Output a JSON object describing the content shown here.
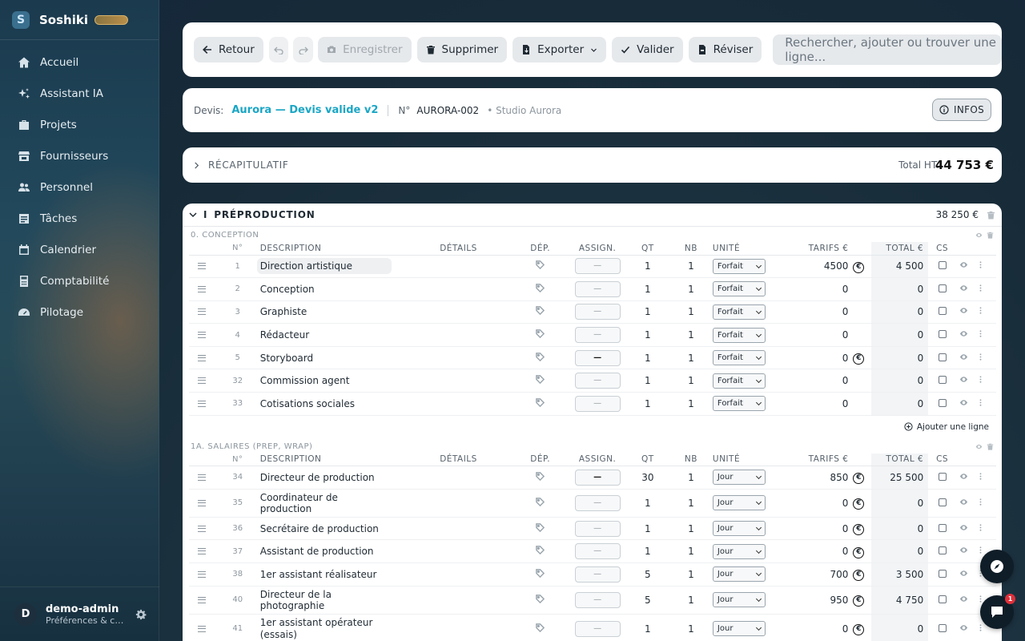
{
  "app": {
    "logo_letter": "S",
    "name": "Soshiki"
  },
  "sidebar": {
    "items": [
      {
        "label": "Accueil",
        "icon": "home-icon"
      },
      {
        "label": "Assistant IA",
        "icon": "sparkle-icon"
      },
      {
        "label": "Projets",
        "icon": "briefcase-icon"
      },
      {
        "label": "Fournisseurs",
        "icon": "store-icon"
      },
      {
        "label": "Personnel",
        "icon": "users-icon"
      },
      {
        "label": "Tâches",
        "icon": "tasks-icon"
      },
      {
        "label": "Calendrier",
        "icon": "calendar-icon"
      },
      {
        "label": "Comptabilité",
        "icon": "calculator-icon"
      },
      {
        "label": "Pilotage",
        "icon": "gauge-icon"
      }
    ]
  },
  "user": {
    "initial": "D",
    "name": "demo-admin",
    "subtitle": "Préférences & co..."
  },
  "toolbar": {
    "back_label": "Retour",
    "save_label": "Enregistrer",
    "delete_label": "Supprimer",
    "export_label": "Exporter",
    "validate_label": "Valider",
    "revise_label": "Réviser",
    "search_placeholder": "Rechercher, ajouter ou trouver une ligne..."
  },
  "devis": {
    "label": "Devis:",
    "title": "Aurora — Devis valide v2",
    "number_label": "N°",
    "number": "AURORA-002",
    "studio": "• Studio Aurora",
    "infos_label": "INFOS"
  },
  "recap": {
    "label": "RÉCAPITULATIF",
    "total_label": "Total HT:",
    "total_value": "44 753 €"
  },
  "section": {
    "roman": "I",
    "name": "PRÉPRODUCTION",
    "amount": "38 250 €"
  },
  "columns": {
    "no": "N°",
    "description": "DESCRIPTION",
    "details": "DÉTAILS",
    "dep": "DÉP.",
    "assign": "ASSIGN.",
    "qt": "QT",
    "nb": "NB",
    "unit": "UNITÉ",
    "tarifs": "TARIFS €",
    "total": "TOTAL €",
    "cs": "CS"
  },
  "groups": [
    {
      "name": "0. CONCEPTION",
      "rows": [
        {
          "no": "1",
          "desc": "Direction artistique",
          "assign": "—",
          "qt": "1",
          "nb": "1",
          "unit": "Forfait",
          "tarif": "4500",
          "euro": true,
          "total": "4 500"
        },
        {
          "no": "2",
          "desc": "Conception",
          "assign": "—",
          "qt": "1",
          "nb": "1",
          "unit": "Forfait",
          "tarif": "0",
          "euro": false,
          "total": "0"
        },
        {
          "no": "3",
          "desc": "Graphiste",
          "assign": "—",
          "qt": "1",
          "nb": "1",
          "unit": "Forfait",
          "tarif": "0",
          "euro": false,
          "total": "0"
        },
        {
          "no": "4",
          "desc": "Rédacteur",
          "assign": "—",
          "qt": "1",
          "nb": "1",
          "unit": "Forfait",
          "tarif": "0",
          "euro": false,
          "total": "0"
        },
        {
          "no": "5",
          "desc": "Storyboard",
          "assign": "—",
          "qt": "1",
          "nb": "1",
          "unit": "Forfait",
          "tarif": "0",
          "euro": true,
          "total": "0"
        },
        {
          "no": "32",
          "desc": "Commission agent",
          "assign": "—",
          "qt": "1",
          "nb": "1",
          "unit": "Forfait",
          "tarif": "0",
          "euro": false,
          "total": "0"
        },
        {
          "no": "33",
          "desc": "Cotisations sociales",
          "assign": "—",
          "qt": "1",
          "nb": "1",
          "unit": "Forfait",
          "tarif": "0",
          "euro": false,
          "total": "0"
        }
      ],
      "add_label": "Ajouter une ligne"
    },
    {
      "name": "1A. SALAIRES (PREP, WRAP)",
      "rows": [
        {
          "no": "34",
          "desc": "Directeur de production",
          "assign": "—",
          "qt": "30",
          "nb": "1",
          "unit": "Jour",
          "tarif": "850",
          "euro": true,
          "total": "25 500"
        },
        {
          "no": "35",
          "desc": "Coordinateur de production",
          "assign": "—",
          "qt": "1",
          "nb": "1",
          "unit": "Jour",
          "tarif": "0",
          "euro": true,
          "total": "0"
        },
        {
          "no": "36",
          "desc": "Secrétaire de production",
          "assign": "—",
          "qt": "1",
          "nb": "1",
          "unit": "Jour",
          "tarif": "0",
          "euro": true,
          "total": "0"
        },
        {
          "no": "37",
          "desc": "Assistant de production",
          "assign": "—",
          "qt": "1",
          "nb": "1",
          "unit": "Jour",
          "tarif": "0",
          "euro": true,
          "total": "0"
        },
        {
          "no": "38",
          "desc": "1er assistant réalisateur",
          "assign": "—",
          "qt": "5",
          "nb": "1",
          "unit": "Jour",
          "tarif": "700",
          "euro": true,
          "total": "3 500"
        },
        {
          "no": "40",
          "desc": "Directeur de la photographie",
          "assign": "—",
          "qt": "5",
          "nb": "1",
          "unit": "Jour",
          "tarif": "950",
          "euro": true,
          "total": "4 750"
        },
        {
          "no": "41",
          "desc": "1er assistant opérateur (essais)",
          "assign": "—",
          "qt": "1",
          "nb": "1",
          "unit": "Jour",
          "tarif": "0",
          "euro": true,
          "total": "0"
        }
      ]
    }
  ],
  "chat_badge": "1"
}
